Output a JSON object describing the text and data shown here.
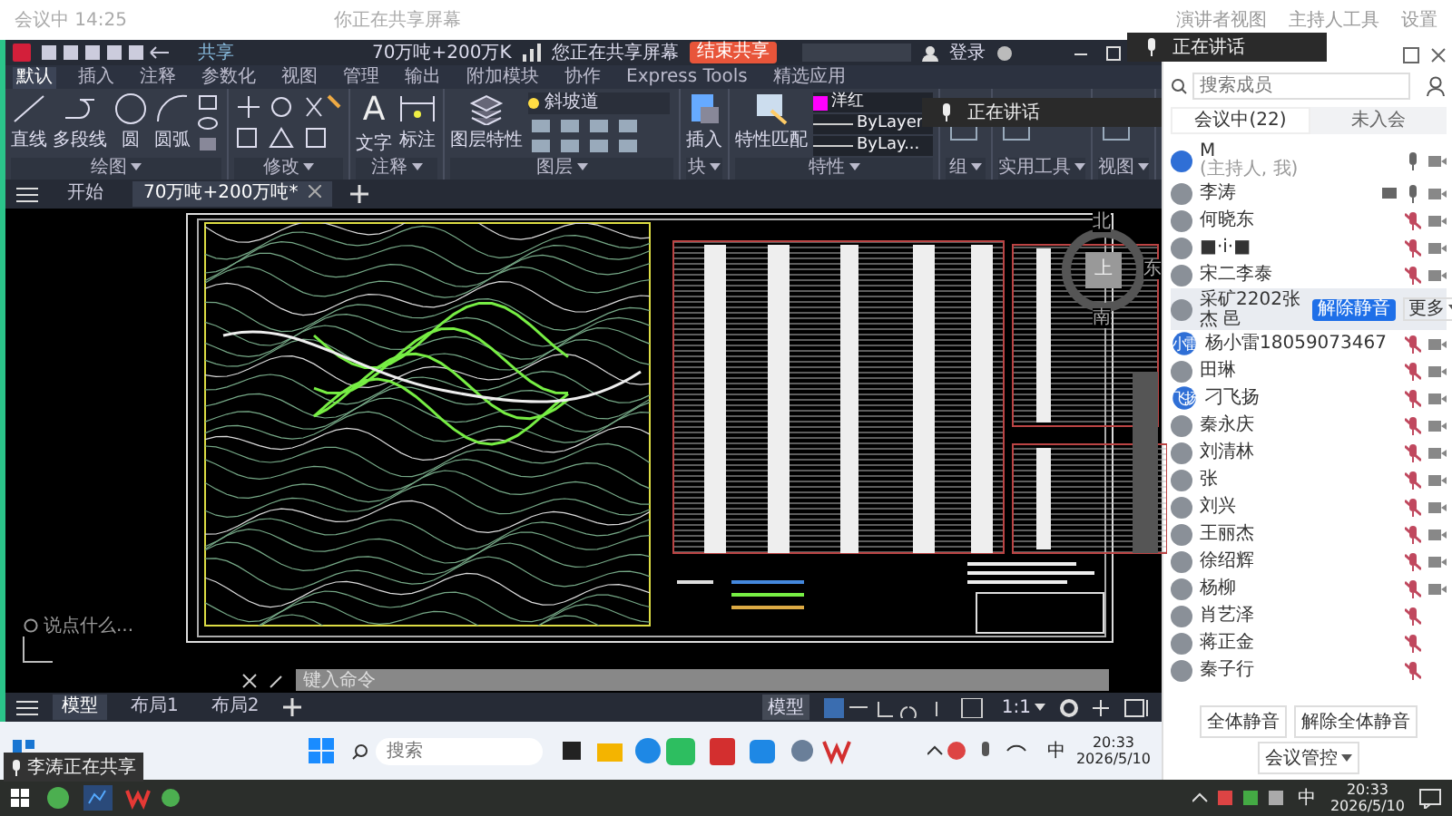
{
  "top_bar": {
    "meeting_info": "会议中 14:25",
    "share_notice": "你正在共享屏幕",
    "tools": [
      "演讲者视图",
      "主持人工具",
      "设置"
    ]
  },
  "cad": {
    "title_bar": {
      "share_label": "共享",
      "file_title": "70万吨+200万K",
      "share_status": "您正在共享屏幕",
      "stop_share": "结束共享",
      "login": "登录"
    },
    "ribbon_tabs": [
      {
        "label": "默认",
        "selected": true
      },
      {
        "label": "插入",
        "selected": false
      },
      {
        "label": "注释",
        "selected": false
      },
      {
        "label": "参数化",
        "selected": false
      },
      {
        "label": "视图",
        "selected": false
      },
      {
        "label": "管理",
        "selected": false
      },
      {
        "label": "输出",
        "selected": false
      },
      {
        "label": "附加模块",
        "selected": false
      },
      {
        "label": "协作",
        "selected": false
      },
      {
        "label": "Express Tools",
        "selected": false
      },
      {
        "label": "精选应用",
        "selected": false
      }
    ],
    "ribbon_groups": [
      {
        "kind": "draw",
        "label": "绘图",
        "tools": [
          "直线",
          "多段线",
          "圆",
          "圆弧"
        ]
      },
      {
        "kind": "modify",
        "label": "修改"
      },
      {
        "kind": "annotate",
        "label": "注释",
        "glyph": "A",
        "tools": [
          "文字",
          "标注"
        ]
      },
      {
        "kind": "layers",
        "label": "图层",
        "tools": [
          "图层特性"
        ],
        "layer": "斜坡道"
      },
      {
        "kind": "block",
        "label": "块",
        "tools": [
          "插入"
        ]
      },
      {
        "kind": "properties",
        "label": "特性",
        "tools": [
          "特性匹配"
        ],
        "color_name": "洋红",
        "linetype": "ByLayer",
        "lineweight": "ByLay..."
      },
      {
        "kind": "group",
        "label": "组"
      },
      {
        "kind": "utilities",
        "label": "实用工具"
      },
      {
        "kind": "view",
        "label": "视图"
      }
    ],
    "speaking_toast": "正在讲话",
    "file_tabs": [
      {
        "label": "开始",
        "selected": false
      },
      {
        "label": "70万吨+200万吨*",
        "selected": true
      }
    ],
    "chat_hint": "说点什么...",
    "view_cube": {
      "north": "北",
      "east": "东",
      "south": "南",
      "top": "上"
    },
    "command_placeholder": "键入命令",
    "layout_tabs": [
      {
        "label": "模型",
        "selected": true
      },
      {
        "label": "布局1",
        "selected": false
      },
      {
        "label": "布局2",
        "selected": false
      }
    ],
    "status": {
      "model_button": "模型",
      "scale": "1:1"
    },
    "taskbar": {
      "search_placeholder": "搜索",
      "ime": "中",
      "time": "20:33",
      "date": "2026/5/10"
    },
    "share_tooltip": "李涛正在共享"
  },
  "panel": {
    "speaking_toast": "正在讲话",
    "search_placeholder": "搜索成员",
    "tabs": [
      {
        "label": "会议中(22)",
        "selected": true
      },
      {
        "label": "未入会",
        "selected": false
      }
    ],
    "participants": [
      {
        "name": "M",
        "subtitle": "(主持人, 我)",
        "kind": "plain-avatar",
        "selected": false,
        "muted": false,
        "video": true,
        "sharing": false
      },
      {
        "name": "李涛",
        "kind": "photo-avatar",
        "selected": false,
        "muted": false,
        "video": true,
        "sharing": true
      },
      {
        "name": "何晓东",
        "kind": "photo-avatar",
        "selected": false,
        "muted": true,
        "video": true,
        "sharing": false
      },
      {
        "name": "■·i·■",
        "kind": "photo-avatar",
        "selected": false,
        "muted": true,
        "video": true,
        "sharing": false
      },
      {
        "name": "宋二李泰",
        "kind": "photo-avatar",
        "selected": false,
        "muted": true,
        "video": true,
        "sharing": false
      },
      {
        "name": "采矿2202张杰 邑",
        "kind": "photo-avatar",
        "selected": true,
        "actions": [
          "解除静音",
          "更多"
        ]
      },
      {
        "name": "杨小雷18059073467",
        "kind": "initials-avatar",
        "avatar_text": "小雷",
        "selected": false,
        "muted": true,
        "video": true,
        "sharing": false
      },
      {
        "name": "田琳",
        "kind": "photo-avatar",
        "selected": false,
        "muted": true,
        "video": true,
        "sharing": false
      },
      {
        "name": "刁飞扬",
        "kind": "initials-avatar",
        "avatar_text": "飞扬",
        "selected": false,
        "muted": true,
        "video": true,
        "sharing": false
      },
      {
        "name": "秦永庆",
        "kind": "photo-avatar",
        "selected": false,
        "muted": true,
        "video": true,
        "sharing": false
      },
      {
        "name": "刘清林",
        "kind": "photo-avatar",
        "selected": false,
        "muted": true,
        "video": true,
        "sharing": false
      },
      {
        "name": "张",
        "kind": "photo-avatar",
        "selected": false,
        "muted": true,
        "video": true,
        "sharing": false
      },
      {
        "name": "刘兴",
        "kind": "photo-avatar",
        "selected": false,
        "muted": true,
        "video": true,
        "sharing": false
      },
      {
        "name": "王丽杰",
        "kind": "photo-avatar",
        "selected": false,
        "muted": true,
        "video": true,
        "sharing": false
      },
      {
        "name": "徐绍辉",
        "kind": "photo-avatar",
        "selected": false,
        "muted": true,
        "video": true,
        "sharing": false
      },
      {
        "name": "杨柳",
        "kind": "photo-avatar",
        "selected": false,
        "muted": true,
        "video": true,
        "sharing": false
      },
      {
        "name": "肖艺泽",
        "kind": "photo-avatar",
        "selected": false,
        "muted": true,
        "video": false,
        "sharing": false
      },
      {
        "name": "蒋正金",
        "kind": "photo-avatar",
        "selected": false,
        "muted": true,
        "video": false,
        "sharing": false
      },
      {
        "name": "秦子行",
        "kind": "photo-avatar",
        "selected": false,
        "muted": true,
        "video": false,
        "sharing": false
      }
    ],
    "footer_buttons": [
      "全体静音",
      "解除全体静音",
      "会议管控"
    ]
  },
  "system_taskbar": {
    "ime": "中",
    "time": "20:33",
    "date": "2026/5/10"
  }
}
